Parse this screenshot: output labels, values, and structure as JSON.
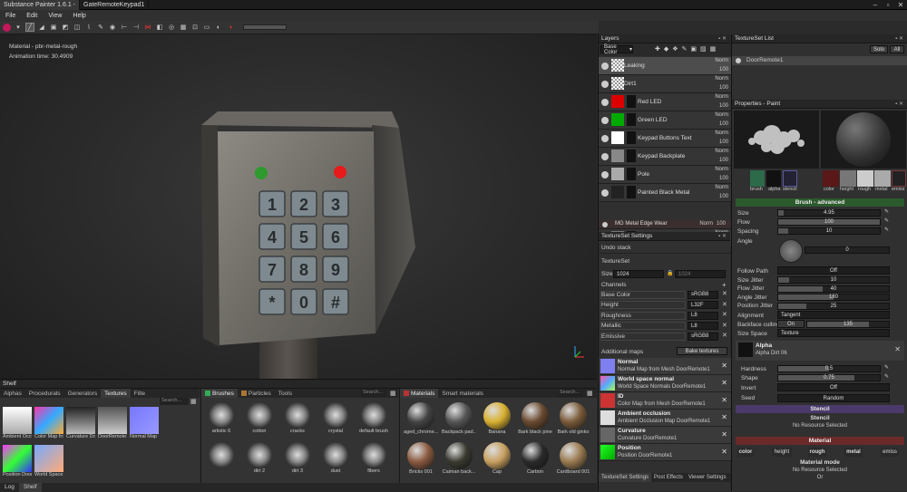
{
  "window": {
    "tabs": [
      "Substance Painter 1.6.1 - ",
      "GateRemoteKeypad1"
    ]
  },
  "menu": [
    "File",
    "Edit",
    "View",
    "Help"
  ],
  "viewport": {
    "material_label": "Material - pbr-metal-rough",
    "anim_label": "Animation time: 30.4909"
  },
  "layers": {
    "title": "Layers",
    "channel": "Base Color",
    "items": [
      {
        "name": "Leaking",
        "blend": "Norm",
        "opacity": "100"
      },
      {
        "name": "Dirt1",
        "blend": "Norm",
        "opacity": "100"
      },
      {
        "name": "Red LED",
        "blend": "Norm",
        "opacity": "100"
      },
      {
        "name": "Green LED",
        "blend": "Norm",
        "opacity": "100"
      },
      {
        "name": "Keypad Buttons Text",
        "blend": "Norm",
        "opacity": "100"
      },
      {
        "name": "Keypad Backplate",
        "blend": "Norm",
        "opacity": "100"
      },
      {
        "name": "Pole",
        "blend": "Norm",
        "opacity": "100"
      },
      {
        "name": "Painted Black Metal",
        "blend": "Norm",
        "opacity": "100"
      },
      {
        "name": "MG Metal Edge Wear",
        "blend": "Norm",
        "opacity": "100"
      },
      {
        "name": "Keypad Buttons",
        "blend": "Norm",
        "opacity": "100"
      }
    ]
  },
  "textureset_settings": {
    "title": "TextureSet Settings",
    "undo": "Undo stack",
    "textureset": "TextureSet",
    "size_label": "Size",
    "size_value": "1024",
    "size_value2": "1024",
    "channels_label": "Channels",
    "channels": [
      {
        "name": "Base Color",
        "format": "sRGB8"
      },
      {
        "name": "Height",
        "format": "L32F"
      },
      {
        "name": "Roughness",
        "format": "L8"
      },
      {
        "name": "Metallic",
        "format": "L8"
      },
      {
        "name": "Emissive",
        "format": "sRGB8"
      }
    ],
    "additional_maps": "Additional maps",
    "bake_button": "Bake textures",
    "maps": [
      {
        "title": "Normal",
        "desc": "Normal Map from Mesh DoorRemote1"
      },
      {
        "title": "World space normal",
        "desc": "World Space Normals DoorRemote1"
      },
      {
        "title": "ID",
        "desc": "Color Map from Mesh DoorRemote1"
      },
      {
        "title": "Ambient occlusion",
        "desc": "Ambient Occlusion Map DoorRemote1"
      },
      {
        "title": "Curvature",
        "desc": "Curvature DoorRemote1"
      },
      {
        "title": "Position",
        "desc": "Position DoorRemote1"
      }
    ],
    "bottom_tabs": [
      "TextureSet Settings",
      "Post Effects",
      "Viewer Settings"
    ]
  },
  "textureset_list": {
    "title": "TextureSet List",
    "solo": "Solo",
    "all": "All",
    "item": "DoorRemote1"
  },
  "properties": {
    "title": "Properties - Paint",
    "brush_tabs": [
      "brush",
      "alpha",
      "stencil"
    ],
    "mat_tabs": [
      "color",
      "height",
      "rough",
      "metal",
      "emiss"
    ],
    "brush_header": "Brush - advanced",
    "params": [
      {
        "label": "Size",
        "value": "4.95",
        "fill": 0.05
      },
      {
        "label": "Flow",
        "value": "100",
        "fill": 1.0
      },
      {
        "label": "Spacing",
        "value": "10",
        "fill": 0.1
      }
    ],
    "angle_label": "Angle",
    "angle_value": "0",
    "follow_path_label": "Follow Path",
    "follow_path_value": "Off",
    "jitters": [
      {
        "label": "Size Jitter",
        "value": "10",
        "fill": 0.1
      },
      {
        "label": "Flow Jitter",
        "value": "40",
        "fill": 0.4
      },
      {
        "label": "Angle Jitter",
        "value": "180",
        "fill": 0.5
      },
      {
        "label": "Position Jitter",
        "value": "25",
        "fill": 0.25
      }
    ],
    "alignment_label": "Alignment",
    "alignment_value": "Tangent",
    "backface_label": "Backface culling",
    "backface_toggle": "On",
    "backface_value": "135",
    "sizespace_label": "Size Space",
    "sizespace_value": "Texture",
    "alpha_title": "Alpha",
    "alpha_name": "Alpha Dirt 06",
    "alpha_params": [
      {
        "label": "Hardness",
        "value": "0.5",
        "fill": 0.5
      },
      {
        "label": "Shape",
        "value": "0.75",
        "fill": 0.75
      }
    ],
    "invert_label": "Invert",
    "invert_value": "Off",
    "seed_label": "Seed",
    "seed_value": "Random",
    "stencil_header": "Stencil",
    "stencil_title": "Stencil",
    "stencil_none": "No Resource Selected",
    "material_header": "Material",
    "material_tabs": [
      "color",
      "height",
      "rough",
      "metal",
      "emiss"
    ],
    "material_mode": "Material mode",
    "material_none": "No Resource Selected",
    "material_or": "Or"
  },
  "shelf": {
    "title": "Shelf",
    "tabs": [
      "Alphas",
      "Procedurals",
      "Generators",
      "Textures",
      "Filte"
    ],
    "search": "Search...",
    "textures": [
      "Ambient Occl...",
      "Color Map fro...",
      "Curvature Do...",
      "DoorRemote1...",
      "Normal Map ...",
      "Position Door...",
      "World Space..."
    ],
    "brush_tabs": [
      "Brushes",
      "Particles",
      "Tools"
    ],
    "brushes": [
      "artistic 6",
      "cotton",
      "cracks",
      "crystal",
      "default brush",
      "",
      "dirt 2",
      "dirt 3",
      "dust",
      "fibers"
    ],
    "material_tabs": [
      "Materials",
      "Smart materials"
    ],
    "materials": [
      "aged_chrome...",
      "Backpack pad...",
      "Banana",
      "Bark black pine",
      "Bark old ginko",
      "Bricks 001",
      "Caiman back...",
      "Cap",
      "Carbon",
      "Cardboard 001"
    ],
    "bottom_tabs": [
      "Log",
      "Shelf"
    ]
  }
}
